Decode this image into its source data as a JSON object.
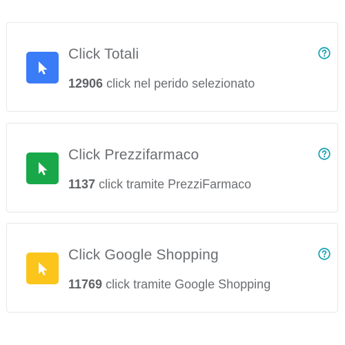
{
  "colors": {
    "blue": "#3a7bf7",
    "green": "#18a84a",
    "yellow": "#fbc51b",
    "help": "#1aa3b3"
  },
  "cards": [
    {
      "icon": "cursor-icon",
      "title": "Click Totali",
      "count": "12906",
      "description": "click nel perido selezionato"
    },
    {
      "icon": "cursor-icon",
      "title": "Click Prezzifarmaco",
      "count": "1137",
      "description": "click tramite PrezziFarmaco"
    },
    {
      "icon": "cursor-icon",
      "title": "Click Google Shopping",
      "count": "11769",
      "description": "click tramite Google Shopping"
    }
  ]
}
